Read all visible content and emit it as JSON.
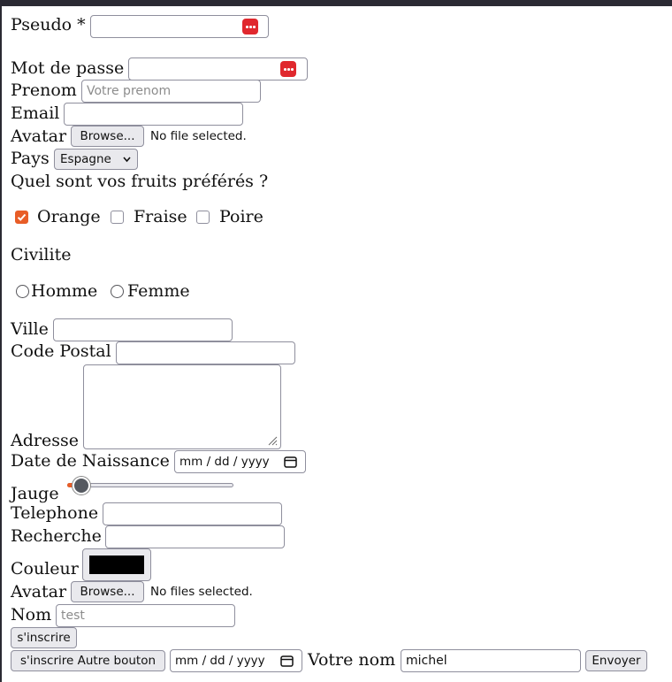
{
  "form": {
    "pseudo_label": "Pseudo *",
    "password_label": "Mot de passe",
    "prenom_label": "Prenom",
    "prenom_placeholder": "Votre prenom",
    "email_label": "Email",
    "avatar_label": "Avatar",
    "browse_label": "Browse...",
    "no_file_text": "No file selected.",
    "pays_label": "Pays",
    "pays_selected": "Espagne",
    "fruits_question": "Quel sont vos fruits préférés ?",
    "fruits": [
      {
        "label": "Orange",
        "checked": true
      },
      {
        "label": "Fraise",
        "checked": false
      },
      {
        "label": "Poire",
        "checked": false
      }
    ],
    "civilite_label": "Civilite",
    "civilite_options": [
      {
        "label": "Homme",
        "selected": false
      },
      {
        "label": "Femme",
        "selected": false
      }
    ],
    "ville_label": "Ville",
    "code_postal_label": "Code Postal",
    "adresse_label": "Adresse",
    "date_naissance_label": "Date de Naissance",
    "date_placeholder": "mm / dd / yyyy",
    "jauge_label": "Jauge",
    "jauge_value_fraction": 0.0,
    "telephone_label": "Telephone",
    "recherche_label": "Recherche",
    "couleur_label": "Couleur",
    "couleur_value": "#000000",
    "avatar2_label": "Avatar",
    "no_files_text": "No files selected.",
    "nom_label": "Nom",
    "nom_placeholder": "test",
    "inscrire_button": "s'inscrire",
    "inscrire_autre_button": "s'inscrire Autre bouton",
    "date2_placeholder": "mm / dd / yyyy",
    "votre_nom_label": "Votre nom",
    "votre_nom_value": "michel",
    "envoyer_button": "Envoyer"
  },
  "colors": {
    "accent": "#e85d27",
    "password_manager": "#e0282e"
  }
}
